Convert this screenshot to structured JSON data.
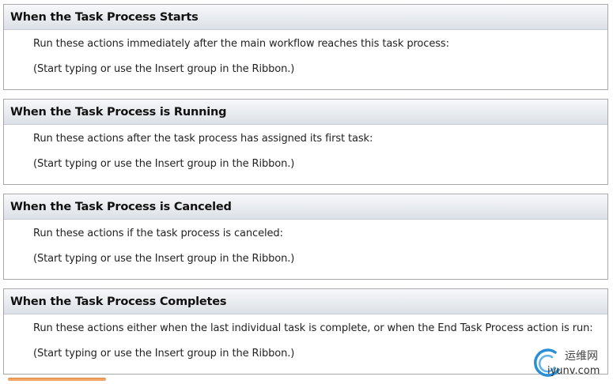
{
  "sections": [
    {
      "title": "When the Task Process Starts",
      "description": "Run these actions immediately after the main workflow reaches this task process:",
      "placeholder": "(Start typing or use the Insert group in the Ribbon.)"
    },
    {
      "title": "When the Task Process is Running",
      "description": "Run these actions after the task process has assigned its first task:",
      "placeholder": "(Start typing or use the Insert group in the Ribbon.)"
    },
    {
      "title": "When the Task Process is Canceled",
      "description": "Run these actions if the task process is canceled:",
      "placeholder": "(Start typing or use the Insert group in the Ribbon.)"
    },
    {
      "title": "When the Task Process Completes",
      "description": "Run these actions  either when the last individual task is complete, or when the End Task Process action is run:",
      "placeholder": "(Start typing or use the Insert group in the Ribbon.)"
    }
  ],
  "watermark": {
    "top_text": "运维网",
    "bottom_text": "iyunv.com",
    "icon": "swirl-logo-icon"
  },
  "colors": {
    "header_gradient_top": "#f7f8fa",
    "header_gradient_bottom": "#dde1e7",
    "border": "#a8a8a8",
    "scrollbar_thumb": "#f2a566",
    "watermark_accent": "#2a8fd6"
  }
}
